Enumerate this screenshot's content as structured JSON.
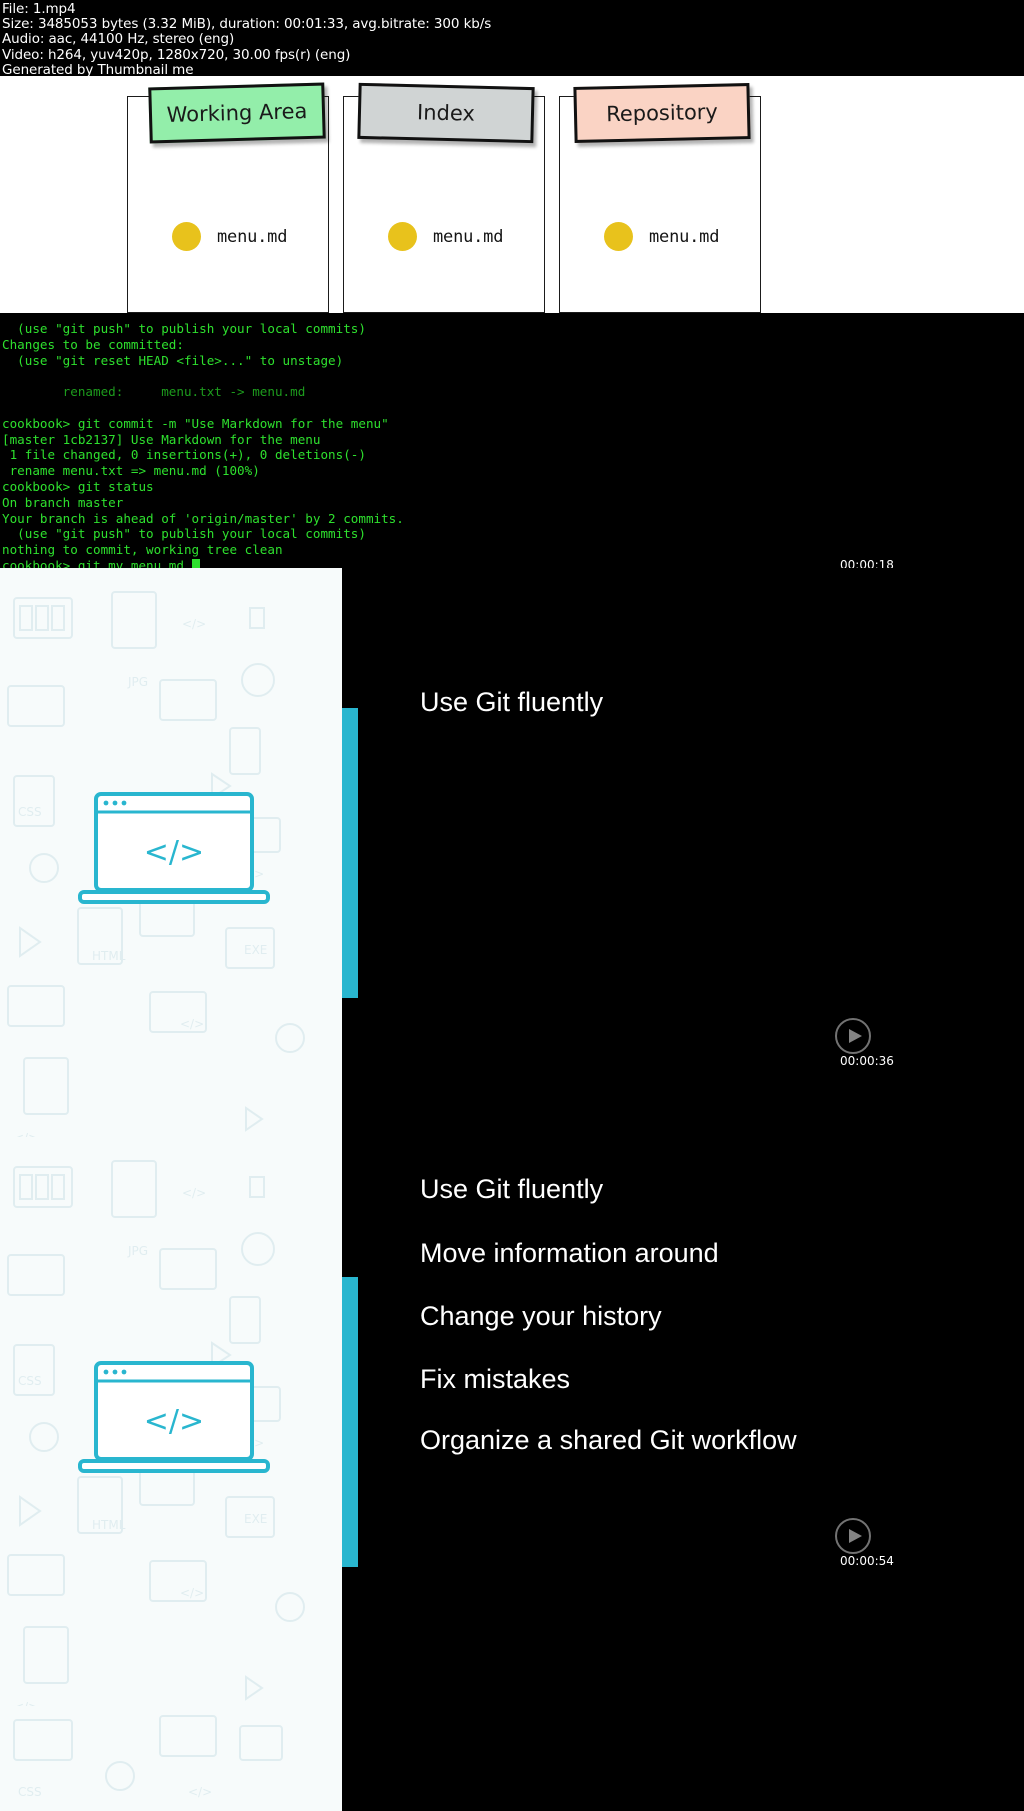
{
  "meta": {
    "lines": [
      "File: 1.mp4",
      "Size: 3485053 bytes (3.32 MiB), duration: 00:01:33, avg.bitrate: 300 kb/s",
      "Audio: aac, 44100 Hz, stereo (eng)",
      "Video: h264, yuv420p, 1280x720, 30.00 fps(r) (eng)",
      "Generated by Thumbnail me"
    ]
  },
  "diagram": {
    "panels": [
      {
        "title": "Working Area",
        "color": "#93eeaa",
        "file": "menu.md"
      },
      {
        "title": "Index",
        "color": "#d0d4d4",
        "file": "menu.md"
      },
      {
        "title": "Repository",
        "color": "#fad3c4",
        "file": "menu.md"
      }
    ]
  },
  "terminal": {
    "prompt": "cookbook>",
    "lines": [
      "  (use \"git push\" to publish your local commits)",
      "Changes to be committed:",
      "  (use \"git reset HEAD <file>...\" to unstage)",
      "",
      "        renamed:     menu.txt -> menu.md",
      "",
      "cookbook> git commit -m \"Use Markdown for the menu\"",
      "[master 1cb2137] Use Markdown for the menu",
      " 1 file changed, 0 insertions(+), 0 deletions(-)",
      " rename menu.txt => menu.md (100%)",
      "cookbook> git status",
      "On branch master",
      "Your branch is ahead of 'origin/master' by 2 commits.",
      "  (use \"git push\" to publish your local commits)",
      "nothing to commit, working tree clean",
      "cookbook> git mv menu.md "
    ],
    "dim_line_indexes": [
      4
    ]
  },
  "slides": [
    {
      "lines": [
        "Use Git fluently"
      ],
      "accent_color": "#29b6cf"
    },
    {
      "lines": [
        "Use Git fluently",
        "Move information around",
        "Change your history",
        "Fix mistakes",
        "Organize a shared Git workflow"
      ],
      "accent_color": "#29b6cf"
    }
  ],
  "timestamps": [
    "00:00:18",
    "00:00:36",
    "00:00:54"
  ],
  "icons": {
    "play": "play-icon"
  }
}
